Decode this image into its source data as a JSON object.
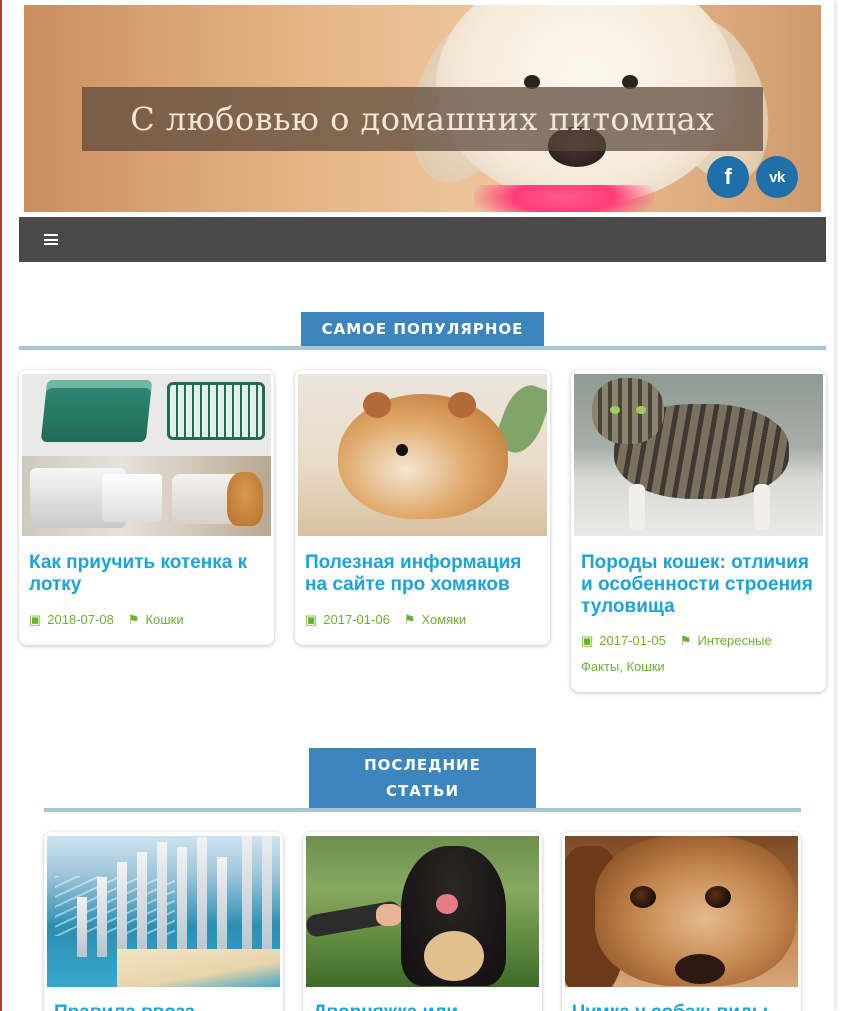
{
  "header": {
    "site_title": "С любовью о домашних питомцах",
    "social": [
      {
        "name": "facebook",
        "glyph": "f",
        "color": "#1f6fa8"
      },
      {
        "name": "vk",
        "glyph": "vk",
        "color": "#1f6fa8"
      }
    ]
  },
  "nav": {
    "menu_icon": "hamburger-icon",
    "background": "#4a4a4a"
  },
  "popular": {
    "heading": "САМОЕ ПОПУЛЯРНОЕ",
    "cards": [
      {
        "title": "Как приучить котенка к лотку",
        "date": "2018-07-08",
        "categories": "Кошки",
        "image": "litter-trays"
      },
      {
        "title": "Полезная информация на сайте про хомяков",
        "date": "2017-01-06",
        "categories": "Хомяки",
        "image": "hamster"
      },
      {
        "title": "Породы кошек: отличия и особенности строения туловища",
        "date": "2017-01-05",
        "categories_line1": "Интересные",
        "categories_line2": "Факты, Кошки",
        "image": "tabby-cat"
      }
    ]
  },
  "latest": {
    "heading_line1": "ПОСЛЕДНИЕ",
    "heading_line2": "СТАТЬИ",
    "cards": [
      {
        "title": "Правила ввоза",
        "image": "city-coast"
      },
      {
        "title": "Дворняжка или",
        "image": "dog-paw"
      },
      {
        "title": "Чумка у собак: виды",
        "image": "beagle"
      }
    ]
  },
  "colors": {
    "accent": "#3d86bd",
    "link": "#1aa3dd",
    "meta": "#6ab12f",
    "section_line": "#a9c5d6"
  }
}
